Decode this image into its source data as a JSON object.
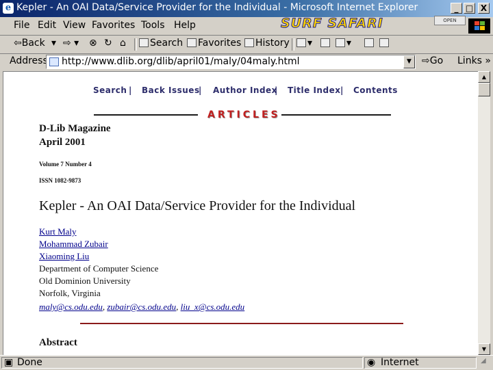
{
  "window": {
    "title": "Kepler - An OAI Data/Service Provider for the Individual - Microsoft Internet Explorer",
    "minimize": "_",
    "maximize": "□",
    "close": "X"
  },
  "menu": [
    "File",
    "Edit",
    "View",
    "Favorites",
    "Tools",
    "Help"
  ],
  "brand": {
    "text": "SURF SAFARI",
    "open_label": "OPEN"
  },
  "toolbar": {
    "back": "Back",
    "search": "Search",
    "favorites": "Favorites",
    "history": "History"
  },
  "address": {
    "label": "Address",
    "url": "http://www.dlib.org/dlib/april01/maly/04maly.html",
    "go": "Go",
    "links": "Links »"
  },
  "page": {
    "nav": [
      "Search",
      "Back Issues",
      "Author Index",
      "Title Index",
      "Contents"
    ],
    "nav_separator": "|",
    "section": "ARTICLES",
    "magazine": "D-Lib Magazine",
    "issue_date": "April 2001",
    "volume": "Volume 7 Number 4",
    "issn": "ISSN 1082-9873",
    "title": "Kepler - An OAI Data/Service Provider for the Individual",
    "authors": [
      "Kurt Maly",
      "Mohammad Zubair",
      "Xiaoming Liu"
    ],
    "affiliation": [
      "Department of Computer Science",
      "Old Dominion University",
      "Norfolk, Virginia"
    ],
    "emails": [
      "maly@cs.odu.edu",
      "zubair@cs.odu.edu",
      "liu_x@cs.odu.edu"
    ],
    "abstract_heading": "Abstract"
  },
  "status": {
    "text": "Done",
    "zone": "Internet"
  },
  "colors": {
    "titlebar_start": "#0a246a",
    "articles_red": "#c02020",
    "link_blue": "#00008b",
    "divider_red": "#8b1a1a"
  }
}
